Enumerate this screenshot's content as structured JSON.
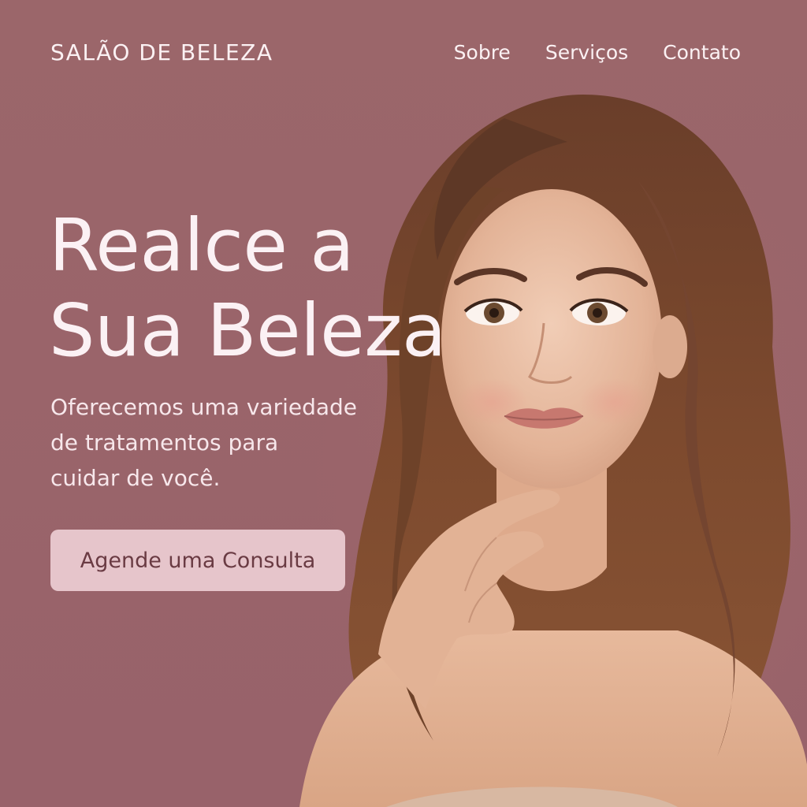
{
  "header": {
    "brand": "SALÃO DE BELEZA",
    "nav": [
      {
        "label": "Sobre"
      },
      {
        "label": "Serviços"
      },
      {
        "label": "Contato"
      }
    ]
  },
  "hero": {
    "headline_line1": "Realce a",
    "headline_line2": "Sua Beleza",
    "subtitle_line1": "Oferecemos uma variedade",
    "subtitle_line2": "de tratamentos para",
    "subtitle_line3": "cuidar de você.",
    "cta_label": "Agende uma Consulta"
  },
  "colors": {
    "background": "#9a6569",
    "text": "#fbf1f3",
    "cta_background": "#e6c5cb",
    "cta_text": "#6a3b43"
  }
}
